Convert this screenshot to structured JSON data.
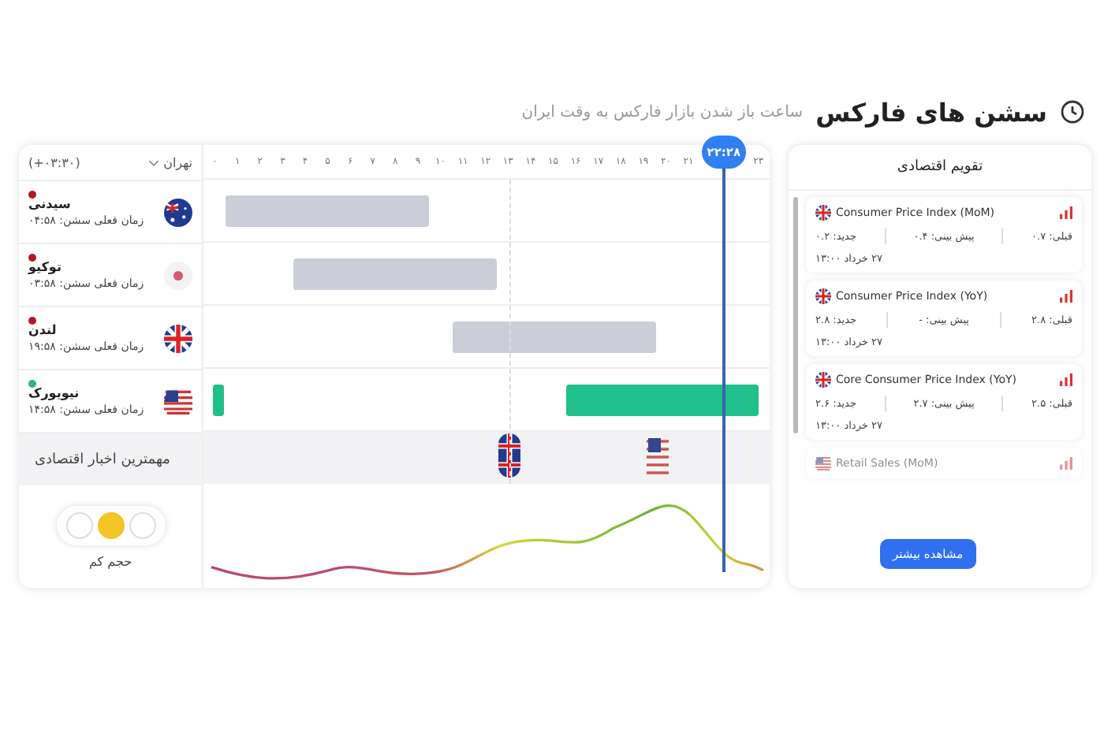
{
  "header": {
    "title": "سشن های فارکس",
    "subtitle": "ساعت باز شدن بازار فارکس به وقت ایران"
  },
  "timezone": {
    "city": "تهران",
    "offset": "(+۰۳:۳۰)"
  },
  "hours": [
    "۲۳",
    "۲۱",
    "۲۰",
    "۱۹",
    "۱۸",
    "۱۷",
    "۱۶",
    "۱۵",
    "۱۴",
    "۱۳",
    "۱۲",
    "۱۱",
    "۱۰",
    "۹",
    "۸",
    "۷",
    "۶",
    "۵",
    "۴",
    "۳",
    "۲",
    "۱",
    "۰"
  ],
  "current_time": "۲۲:۲۸",
  "sessions": [
    {
      "name": "سیدنی",
      "time": "زمان فعلی سشن: ۰۴:۵۸",
      "kind": "au",
      "open": false
    },
    {
      "name": "توکیو",
      "time": "زمان فعلی سشن: ۰۳:۵۸",
      "kind": "jp",
      "open": false
    },
    {
      "name": "لندن",
      "time": "زمان فعلی سشن: ۱۹:۵۸",
      "kind": "gb",
      "open": false
    },
    {
      "name": "نیویورک",
      "time": "زمان فعلی سشن: ۱۴:۵۸",
      "kind": "us",
      "open": true
    }
  ],
  "news": {
    "label": "مهمترین اخبار اقتصادی",
    "markers": [
      {
        "kind": "gb"
      },
      {
        "kind": "us"
      }
    ]
  },
  "volume": {
    "label": "حجم کم",
    "lights": [
      {
        "on": false
      },
      {
        "on": true
      },
      {
        "on": false
      }
    ]
  },
  "calendar": {
    "title": "تقویم اقتصادی",
    "button": "مشاهده بیشتر",
    "events": [
      {
        "kind": "gb",
        "title": "Consumer Price Index (MoM)",
        "previous": "قبلی: ۰.۷",
        "forecast": "پیش بینی: ۰.۴",
        "actual": "جدید: ۰.۲",
        "date": "۲۷ خرداد ۱۳:۰۰"
      },
      {
        "kind": "gb",
        "title": "Consumer Price Index (YoY)",
        "previous": "قبلی: ۲.۸",
        "forecast": "پیش بینی: -",
        "actual": "جدید: ۲.۸",
        "date": "۲۷ خرداد ۱۳:۰۰"
      },
      {
        "kind": "gb",
        "title": "Core Consumer Price Index (YoY)",
        "previous": "قبلی: ۲.۵",
        "forecast": "پیش بینی: ۲.۷",
        "actual": "جدید: ۲.۶",
        "date": "۲۷ خرداد ۱۳:۰۰"
      },
      {
        "kind": "us",
        "title": "Retail Sales (MoM)"
      }
    ]
  }
}
